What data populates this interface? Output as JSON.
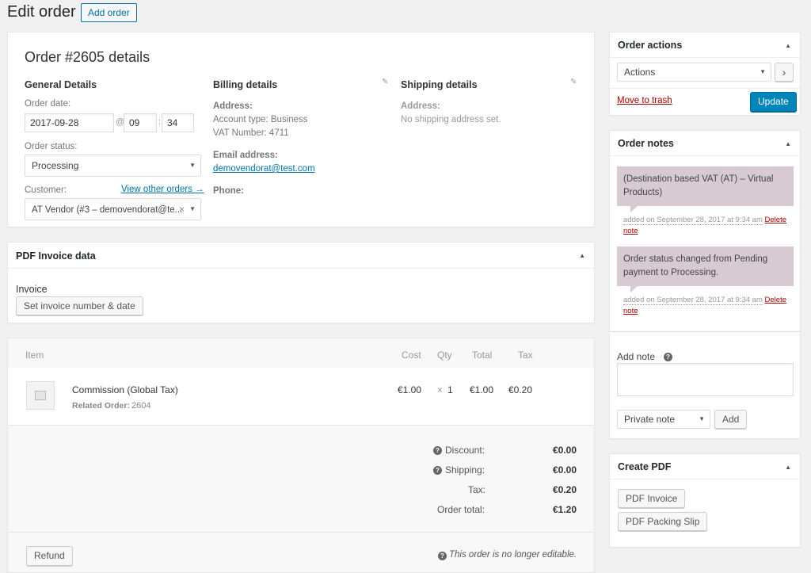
{
  "header": {
    "title": "Edit order",
    "add_order_label": "Add order"
  },
  "order": {
    "title": "Order #2605 details",
    "general": {
      "heading": "General Details",
      "date_label": "Order date:",
      "date_value": "2017-09-28",
      "at_sep": "@",
      "hour": "09",
      "colon_sep": ":",
      "minute": "34",
      "status_label": "Order status:",
      "status_value": "Processing",
      "customer_label": "Customer:",
      "view_other_orders": "View other orders →",
      "customer_value": "AT Vendor (#3 – demovendorat@te...",
      "customer_clear": "×"
    },
    "billing": {
      "heading": "Billing details",
      "address_label": "Address:",
      "address_line1": "Account type: Business",
      "address_line2": "VAT Number: 4711",
      "email_label": "Email address:",
      "email_value": "demovendorat@test.com",
      "phone_label": "Phone:"
    },
    "shipping": {
      "heading": "Shipping details",
      "address_label": "Address:",
      "address_value": "No shipping address set."
    }
  },
  "pdf_invoice": {
    "title": "PDF Invoice data",
    "invoice_label": "Invoice",
    "set_button": "Set invoice number & date"
  },
  "items": {
    "headers": {
      "item": "Item",
      "cost": "Cost",
      "qty": "Qty",
      "total": "Total",
      "tax": "Tax"
    },
    "rows": [
      {
        "name": "Commission (Global Tax)",
        "meta_label": "Related Order:",
        "meta_value": "2604",
        "cost": "€1.00",
        "qty_x": "×",
        "qty": "1",
        "total": "€1.00",
        "tax": "€0.20"
      }
    ],
    "totals": [
      {
        "label": "Discount:",
        "value": "€0.00",
        "help": true
      },
      {
        "label": "Shipping:",
        "value": "€0.00",
        "help": true
      },
      {
        "label": "Tax:",
        "value": "€0.20",
        "help": false
      },
      {
        "label": "Order total:",
        "value": "€1.20",
        "help": false
      }
    ],
    "refund_label": "Refund",
    "not_editable": "This order is no longer editable."
  },
  "order_actions": {
    "title": "Order actions",
    "select_value": "Actions",
    "go_label": "›",
    "trash_label": "Move to trash",
    "update_label": "Update"
  },
  "order_notes": {
    "title": "Order notes",
    "notes": [
      {
        "text": "(Destination based VAT (AT) – Virtual Products)",
        "meta": "added on September 28, 2017 at 9:34 am",
        "delete": "Delete note"
      },
      {
        "text": "Order status changed from Pending payment to Processing.",
        "meta": "added on September 28, 2017 at 9:34 am",
        "delete": "Delete note"
      }
    ],
    "add_note_label": "Add note",
    "help_icon": "?",
    "note_type": "Private note",
    "add_button": "Add"
  },
  "create_pdf": {
    "title": "Create PDF",
    "invoice_button": "PDF Invoice",
    "packing_button": "PDF Packing Slip"
  },
  "colors": {
    "accent": "#0073aa",
    "primary_button": "#0085ba",
    "note_bg": "#d7cad2",
    "danger": "#aa0000"
  }
}
